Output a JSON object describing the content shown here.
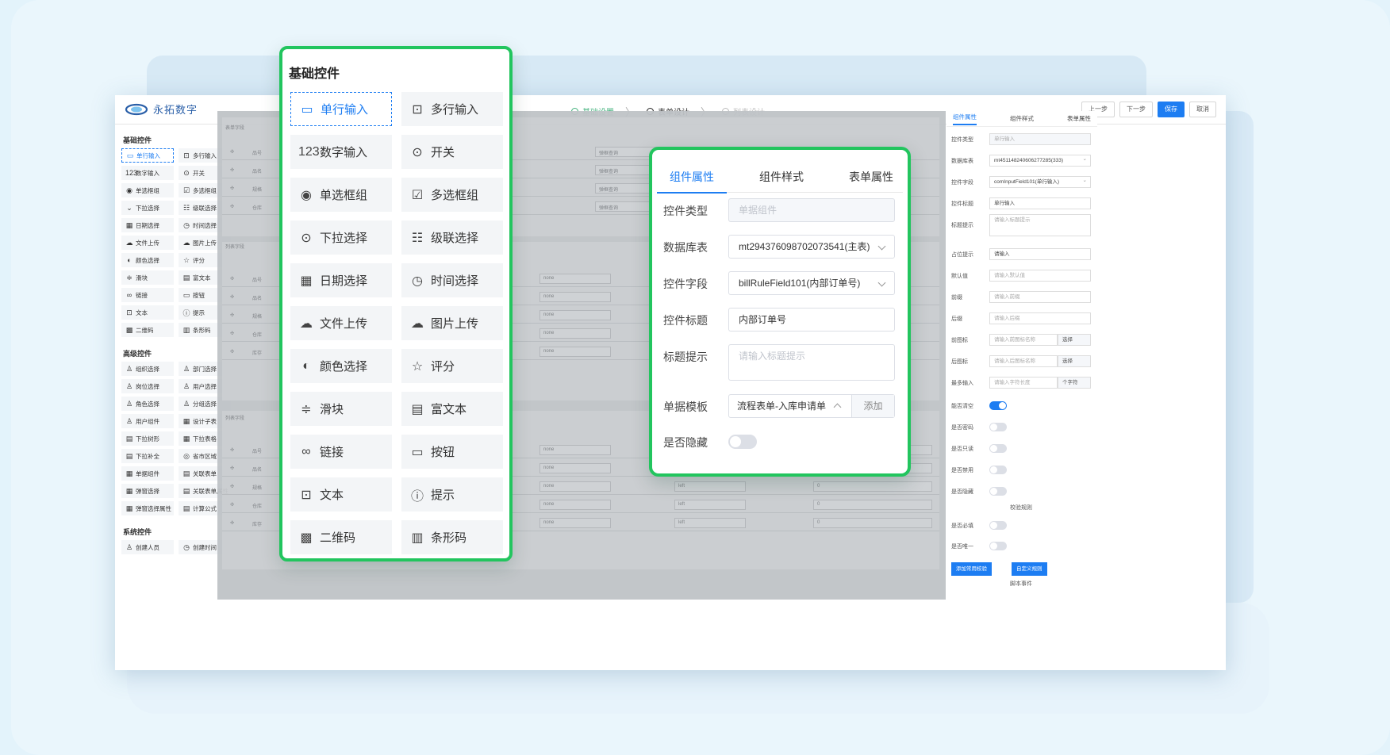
{
  "brand": "永拓数字",
  "steps": [
    "基础设置",
    "表单设计",
    "列表设计"
  ],
  "top_buttons": {
    "prev": "上一步",
    "next": "下一步",
    "save": "保存",
    "cancel": "取消"
  },
  "left": {
    "basic_title": "基础控件",
    "basic": [
      {
        "icon": "▭",
        "label": "单行输入"
      },
      {
        "icon": "⊡",
        "label": "多行输入"
      },
      {
        "icon": "123",
        "label": "数字输入"
      },
      {
        "icon": "⊙",
        "label": "开关"
      },
      {
        "icon": "◉",
        "label": "单选框组"
      },
      {
        "icon": "☑",
        "label": "多选框组"
      },
      {
        "icon": "⌄",
        "label": "下拉选择"
      },
      {
        "icon": "☷",
        "label": "级联选择"
      },
      {
        "icon": "▦",
        "label": "日期选择"
      },
      {
        "icon": "◷",
        "label": "时间选择"
      },
      {
        "icon": "☁",
        "label": "文件上传"
      },
      {
        "icon": "☁",
        "label": "图片上传"
      },
      {
        "icon": "◐",
        "label": "颜色选择"
      },
      {
        "icon": "☆",
        "label": "评分"
      },
      {
        "icon": "≑",
        "label": "滑块"
      },
      {
        "icon": "▤",
        "label": "富文本"
      },
      {
        "icon": "∞",
        "label": "链接"
      },
      {
        "icon": "▭",
        "label": "按钮"
      },
      {
        "icon": "⊡",
        "label": "文本"
      },
      {
        "icon": "ⓘ",
        "label": "提示"
      },
      {
        "icon": "▩",
        "label": "二维码"
      },
      {
        "icon": "▥",
        "label": "条形码"
      }
    ],
    "adv_title": "高级控件",
    "advanced": [
      {
        "icon": "♙",
        "label": "组织选择"
      },
      {
        "icon": "♙",
        "label": "部门选择"
      },
      {
        "icon": "♙",
        "label": "岗位选择"
      },
      {
        "icon": "♙",
        "label": "用户选择"
      },
      {
        "icon": "♙",
        "label": "角色选择"
      },
      {
        "icon": "♙",
        "label": "分组选择"
      },
      {
        "icon": "♙",
        "label": "用户组件"
      },
      {
        "icon": "▦",
        "label": "设计子表"
      },
      {
        "icon": "▤",
        "label": "下拉树形"
      },
      {
        "icon": "▦",
        "label": "下拉表格"
      },
      {
        "icon": "▤",
        "label": "下拉补全"
      },
      {
        "icon": "◎",
        "label": "省市区域"
      },
      {
        "icon": "▦",
        "label": "单据组件"
      },
      {
        "icon": "▤",
        "label": "关联表单"
      },
      {
        "icon": "▦",
        "label": "弹窗选择"
      },
      {
        "icon": "▤",
        "label": "关联表单属性"
      },
      {
        "icon": "▦",
        "label": "弹窗选择属性"
      },
      {
        "icon": "▤",
        "label": "计算公式"
      }
    ],
    "sys_title": "系统控件",
    "system": [
      {
        "icon": "♙",
        "label": "创建人员"
      },
      {
        "icon": "◷",
        "label": "创建时间"
      }
    ]
  },
  "palette": {
    "title": "基础控件",
    "items": [
      {
        "icon": "▭",
        "label": "单行输入"
      },
      {
        "icon": "⊡",
        "label": "多行输入"
      },
      {
        "icon": "123",
        "label": "数字输入"
      },
      {
        "icon": "⊙",
        "label": "开关"
      },
      {
        "icon": "◉",
        "label": "单选框组"
      },
      {
        "icon": "☑",
        "label": "多选框组"
      },
      {
        "icon": "⊙",
        "label": "下拉选择"
      },
      {
        "icon": "☷",
        "label": "级联选择"
      },
      {
        "icon": "▦",
        "label": "日期选择"
      },
      {
        "icon": "◷",
        "label": "时间选择"
      },
      {
        "icon": "☁",
        "label": "文件上传"
      },
      {
        "icon": "☁",
        "label": "图片上传"
      },
      {
        "icon": "◐",
        "label": "颜色选择"
      },
      {
        "icon": "☆",
        "label": "评分"
      },
      {
        "icon": "≑",
        "label": "滑块"
      },
      {
        "icon": "▤",
        "label": "富文本"
      },
      {
        "icon": "∞",
        "label": "链接"
      },
      {
        "icon": "▭",
        "label": "按钮"
      },
      {
        "icon": "⊡",
        "label": "文本"
      },
      {
        "icon": "ⓘ",
        "label": "提示"
      },
      {
        "icon": "▩",
        "label": "二维码"
      },
      {
        "icon": "▥",
        "label": "条形码"
      }
    ]
  },
  "props": {
    "tabs": [
      "组件属性",
      "组件样式",
      "表单属性"
    ],
    "type_label": "控件类型",
    "type_value": "单据组件",
    "table_label": "数据库表",
    "table_value": "mt294376098702073541(主表)",
    "field_label": "控件字段",
    "field_value": "billRuleField101(内部订单号)",
    "title_label": "控件标题",
    "title_value": "内部订单号",
    "tip_label": "标题提示",
    "tip_placeholder": "请输入标题提示",
    "tpl_label": "单据模板",
    "tpl_value": "流程表单-入库申请单",
    "tpl_add": "添加",
    "hide_label": "是否隐藏"
  },
  "right": {
    "tabs": [
      "组件属性",
      "组件样式",
      "表单属性"
    ],
    "rows": [
      {
        "label": "控件类型",
        "value": "单行输入",
        "kind": "dis"
      },
      {
        "label": "数据库表",
        "value": "mt451148240606277285(333)",
        "kind": "dd"
      },
      {
        "label": "控件字段",
        "value": "comInputField101(单行输入)",
        "kind": "dd"
      },
      {
        "label": "控件标题",
        "value": "单行输入",
        "kind": "val"
      },
      {
        "label": "标题提示",
        "value": "请输入标题提示",
        "kind": "ph"
      },
      {
        "label": "占位提示",
        "value": "请输入",
        "kind": "val"
      },
      {
        "label": "默认值",
        "value": "请输入默认值",
        "kind": "ph"
      },
      {
        "label": "前缀",
        "value": "请输入前缀",
        "kind": "ph"
      },
      {
        "label": "后缀",
        "value": "请输入后缀",
        "kind": "ph"
      },
      {
        "label": "前图标",
        "value": "请输入前图标名称",
        "kind": "ph",
        "btn": "选择"
      },
      {
        "label": "后图标",
        "value": "请输入后图标名称",
        "kind": "ph",
        "btn": "选择"
      },
      {
        "label": "最多输入",
        "value": "请输入字符长度",
        "kind": "ph",
        "btn": "个字符"
      }
    ],
    "toggles": [
      {
        "label": "能否清空",
        "on": true
      },
      {
        "label": "是否密码",
        "on": false
      },
      {
        "label": "是否只读",
        "on": false
      },
      {
        "label": "是否禁用",
        "on": false
      },
      {
        "label": "是否隐藏",
        "on": false
      }
    ],
    "rules_title": "校验规则",
    "rule_toggles": [
      {
        "label": "是否必填",
        "on": false
      },
      {
        "label": "是否唯一",
        "on": false
      }
    ],
    "btn_rule": "添加常用校验",
    "btn_custom": "自定义规则",
    "script_title": "脚本事件"
  },
  "canvas": {
    "main_title": "表单字段",
    "sub_title": "列表字段",
    "sub2_title": "列表字段",
    "rows1": [
      "品号",
      "品名",
      "规格",
      "仓库"
    ],
    "rows2": [
      "品号",
      "品名",
      "规格",
      "仓库",
      "库存"
    ],
    "rows3": [
      "品号",
      "品名",
      "规格",
      "仓库",
      "库存"
    ],
    "sel_text": "none",
    "left_text": "left",
    "zero": "0",
    "query": "弹框查询"
  }
}
